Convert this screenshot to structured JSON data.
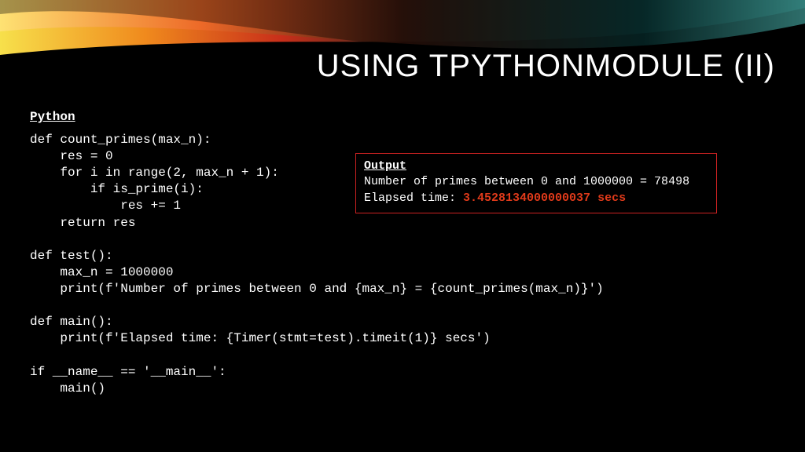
{
  "title": "USING TPYTHONMODULE (II)",
  "code": {
    "label": "Python",
    "body": "def count_primes(max_n):\n    res = 0\n    for i in range(2, max_n + 1):\n        if is_prime(i):\n            res += 1\n    return res\n\ndef test():\n    max_n = 1000000\n    print(f'Number of primes between 0 and {max_n} = {count_primes(max_n)}')\n\ndef main():\n    print(f'Elapsed time: {Timer(stmt=test).timeit(1)} secs')\n\nif __name__ == '__main__':\n    main()"
  },
  "output": {
    "heading": "Output",
    "line1": "Number of primes between 0 and 1000000 = 78498",
    "line2_prefix": "Elapsed time: ",
    "line2_time": "3.4528134000000037",
    "line2_unit": " secs"
  }
}
